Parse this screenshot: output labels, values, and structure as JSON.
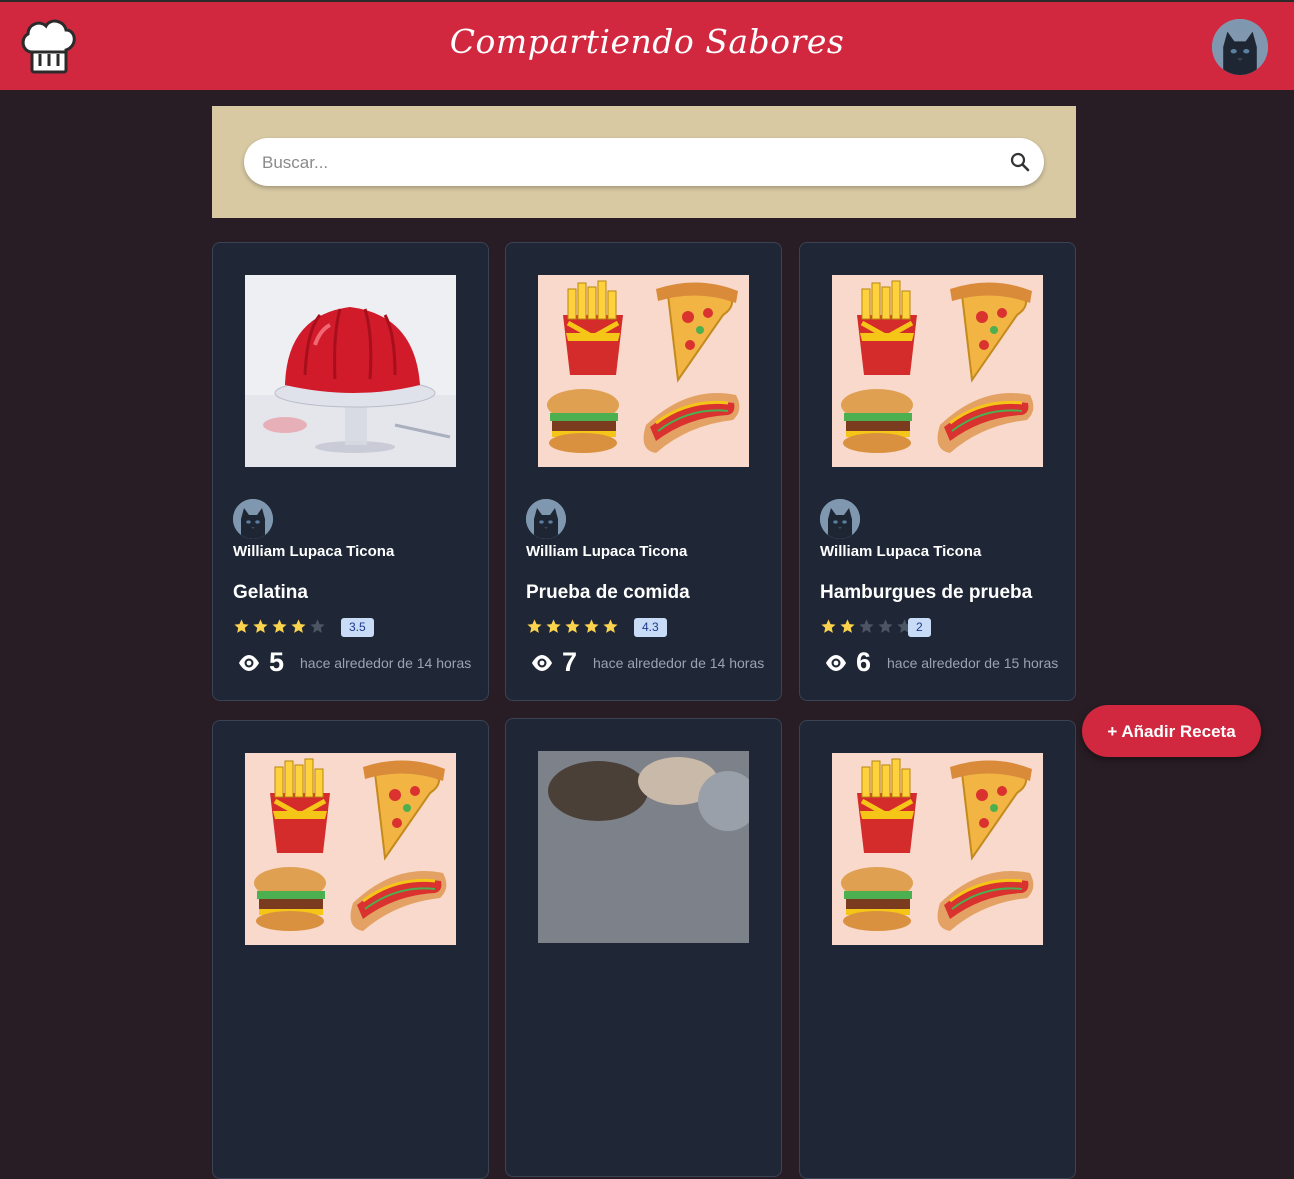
{
  "header": {
    "title": "Compartiendo Sabores",
    "logo_icon": "chef-hat-icon",
    "avatar_icon": "user-avatar-cat"
  },
  "search": {
    "placeholder": "Buscar...",
    "value": "",
    "icon": "search-icon"
  },
  "cards": [
    {
      "author": "William Lupaca Ticona",
      "title": "Gelatina",
      "rating_label": "3.5",
      "rating": 3.5,
      "stars_filled": 4,
      "views": "5",
      "time_ago": "hace alrededor de 14 horas",
      "image": "red-jelly-photo"
    },
    {
      "author": "William Lupaca Ticona",
      "title": "Prueba de comida",
      "rating_label": "4.3",
      "rating": 4.3,
      "stars_filled": 5,
      "views": "7",
      "time_ago": "hace alrededor de 14 horas",
      "image": "fast-food-illustration"
    },
    {
      "author": "William Lupaca Ticona",
      "title": "Hamburgues de prueba",
      "rating_label": "2",
      "rating": 2,
      "stars_filled": 2,
      "views": "6",
      "time_ago": "hace alrededor de 15 horas",
      "image": "fast-food-illustration"
    }
  ],
  "fab": {
    "label": "+ Añadir Receta"
  },
  "colors": {
    "brand": "#d12840",
    "background": "#281d24",
    "card": "#1f2736",
    "search_panel": "#d8c9a3",
    "star": "#fcd34d",
    "star_empty": "#4b5563",
    "badge": "#c9dcf7"
  }
}
